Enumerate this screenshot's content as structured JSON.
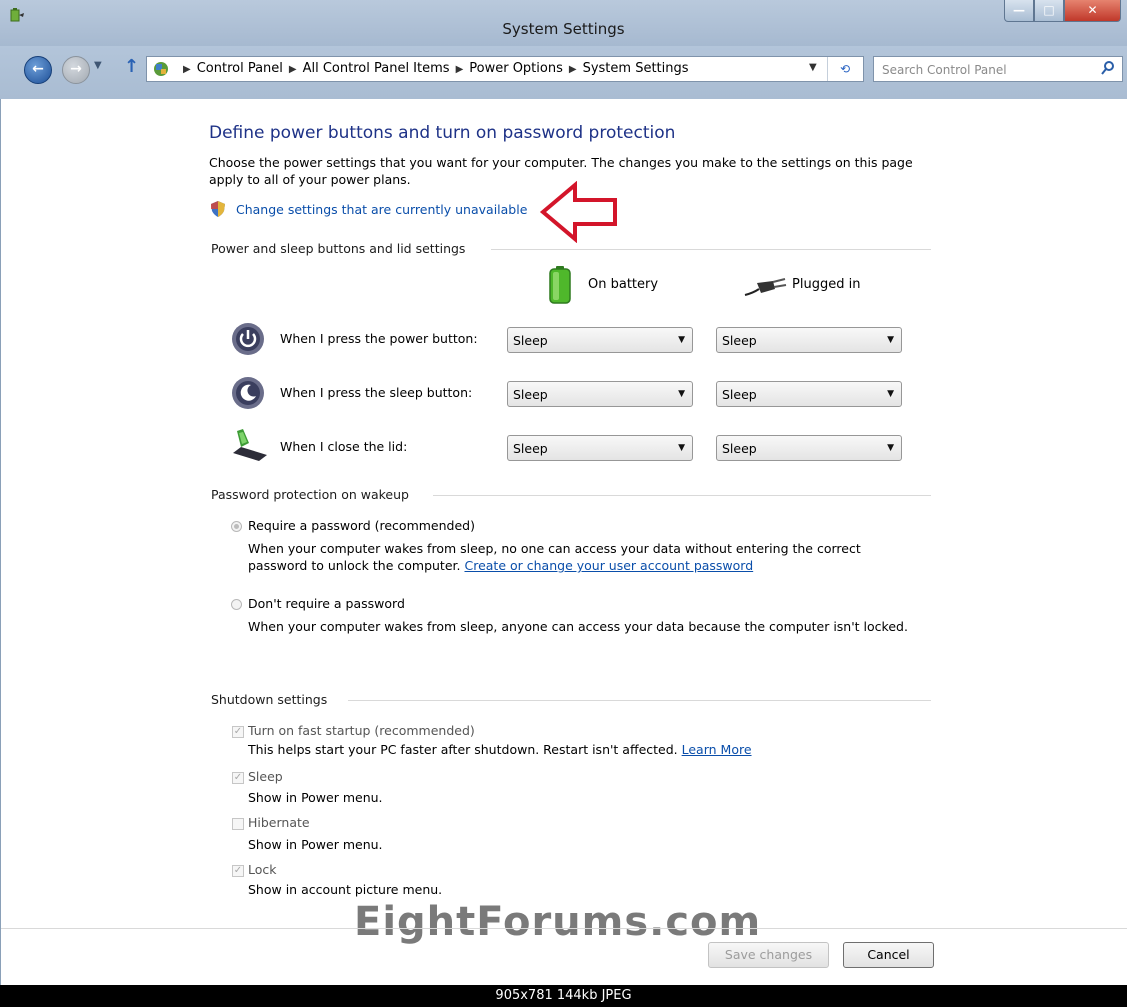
{
  "window": {
    "title": "System Settings",
    "minimize_glyph": "—",
    "maximize_glyph": "□",
    "close_glyph": "✕"
  },
  "address_bar": {
    "breadcrumbs": [
      "Control Panel",
      "All Control Panel Items",
      "Power Options",
      "System Settings"
    ],
    "search_placeholder": "Search Control Panel"
  },
  "main": {
    "title": "Define power buttons and turn on password protection",
    "description": "Choose the power settings that you want for your computer. The changes you make to the settings on this page apply to all of your power plans.",
    "change_link": "Change settings that are currently unavailable"
  },
  "power_section": {
    "heading": "Power and sleep buttons and lid settings",
    "col_battery": "On battery",
    "col_plugged": "Plugged in",
    "rows": [
      {
        "label": "When I press the power button:",
        "battery": "Sleep",
        "plugged": "Sleep"
      },
      {
        "label": "When I press the sleep button:",
        "battery": "Sleep",
        "plugged": "Sleep"
      },
      {
        "label": "When I close the lid:",
        "battery": "Sleep",
        "plugged": "Sleep"
      }
    ]
  },
  "password_section": {
    "heading": "Password protection on wakeup",
    "require_label": "Require a password (recommended)",
    "require_desc": "When your computer wakes from sleep, no one can access your data without entering the correct password to unlock the computer.",
    "require_link": "Create or change your user account password",
    "norequire_label": "Don't require a password",
    "norequire_desc": "When your computer wakes from sleep, anyone can access your data because the computer isn't locked.",
    "selected": "require"
  },
  "shutdown_section": {
    "heading": "Shutdown settings",
    "items": [
      {
        "label": "Turn on fast startup (recommended)",
        "desc": "This helps start your PC faster after shutdown. Restart isn't affected.",
        "link": "Learn More",
        "checked": true
      },
      {
        "label": "Sleep",
        "desc": "Show in Power menu.",
        "checked": true
      },
      {
        "label": "Hibernate",
        "desc": "Show in Power menu.",
        "checked": false
      },
      {
        "label": "Lock",
        "desc": "Show in account picture menu.",
        "checked": true
      }
    ]
  },
  "buttons": {
    "save": "Save changes",
    "cancel": "Cancel"
  },
  "watermark": "EightForums.com",
  "status_text": "905x781  144kb  JPEG"
}
